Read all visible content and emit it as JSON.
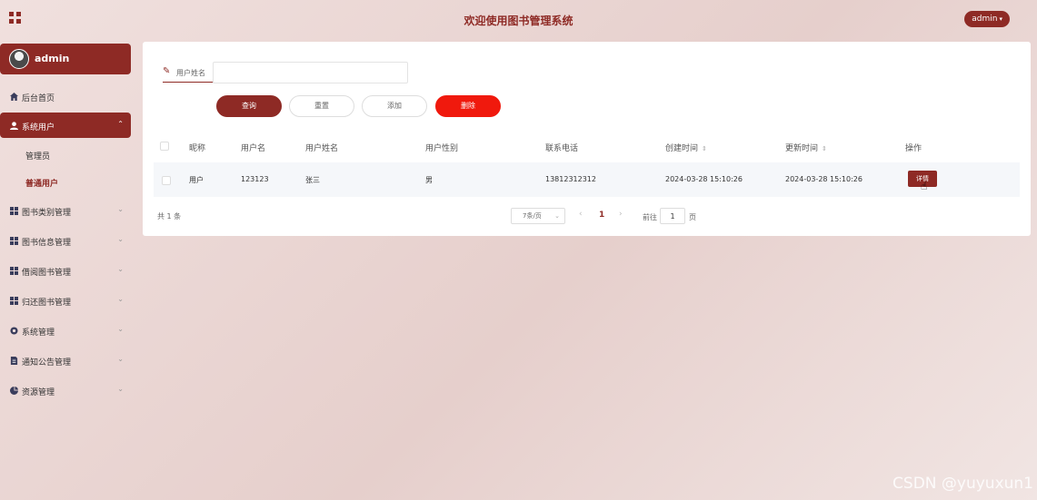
{
  "header": {
    "title": "欢迎使用图书管理系统",
    "user_menu_label": "admin",
    "chevron_glyph": "⌄"
  },
  "sidebar": {
    "profile_name": "admin",
    "items": [
      {
        "label": "后台首页",
        "icon": "home-icon"
      },
      {
        "label": "系统用户",
        "icon": "user-icon",
        "active": true,
        "children": [
          "管理员",
          "普通用户"
        ],
        "current_child": "普通用户"
      },
      {
        "label": "图书类别管理",
        "icon": "grid-icon"
      },
      {
        "label": "图书信息管理",
        "icon": "grid-icon"
      },
      {
        "label": "借阅图书管理",
        "icon": "grid-icon"
      },
      {
        "label": "归还图书管理",
        "icon": "grid-icon"
      },
      {
        "label": "系统管理",
        "icon": "gear-icon"
      },
      {
        "label": "通知公告管理",
        "icon": "document-icon"
      },
      {
        "label": "资源管理",
        "icon": "pie-chart-icon"
      }
    ]
  },
  "search": {
    "label": "用户姓名",
    "value": "",
    "placeholder": ""
  },
  "toolbar": {
    "query_label": "查询",
    "reset_label": "重置",
    "add_label": "添加",
    "delete_label": "删除"
  },
  "table": {
    "columns": [
      "昵称",
      "用户名",
      "用户姓名",
      "用户性别",
      "联系电话",
      "创建时间",
      "更新时间",
      "操作"
    ],
    "rows": [
      {
        "nickname": "用户",
        "username": "123123",
        "real_name": "张三",
        "gender": "男",
        "phone": "13812312312",
        "created": "2024-03-28 15:10:26",
        "updated": "2024-03-28 15:10:26",
        "action": "详情"
      }
    ]
  },
  "pagination": {
    "total": "共 1 条",
    "page_size": "7条/页",
    "current_page": "1",
    "goto_label": "前往",
    "goto_value": "1",
    "page_unit": "页"
  },
  "watermark": "CSDN @yuyuxun1",
  "colors": {
    "primary": "#8e2a25",
    "danger": "#f0190d"
  }
}
